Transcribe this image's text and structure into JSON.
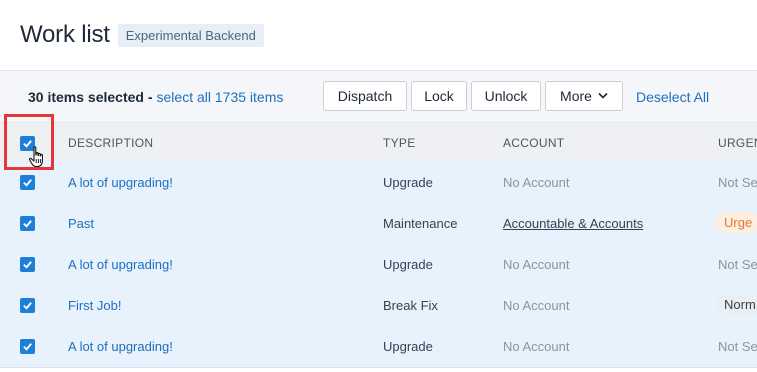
{
  "header": {
    "title": "Work list",
    "badge": "Experimental Backend"
  },
  "selection_bar": {
    "selected_text": "30 items selected -",
    "select_all_text": "select all 1735 items",
    "buttons": {
      "dispatch": "Dispatch",
      "lock": "Lock",
      "unlock": "Unlock",
      "more": "More"
    },
    "deselect_all": "Deselect All"
  },
  "columns": {
    "description": "DESCRIPTION",
    "type": "TYPE",
    "account": "ACCOUNT",
    "urgency": "URGEN"
  },
  "rows": [
    {
      "description": "A lot of upgrading!",
      "type": "Upgrade",
      "account": "No Account",
      "urgency": "Not Se"
    },
    {
      "description": "Past",
      "type": "Maintenance",
      "account": "Accountable & Accounts",
      "urgency": "Urge"
    },
    {
      "description": "A lot of upgrading!",
      "type": "Upgrade",
      "account": "No Account",
      "urgency": "Not Se"
    },
    {
      "description": "First Job!",
      "type": "Break Fix",
      "account": "No Account",
      "urgency": "Norm"
    },
    {
      "description": "A lot of upgrading!",
      "type": "Upgrade",
      "account": "No Account",
      "urgency": "Not Se"
    }
  ],
  "colors": {
    "accent": "#1d7fd8",
    "link": "#1e6fbf",
    "highlight": "#e8353b",
    "row_bg": "#e8f2fc"
  }
}
